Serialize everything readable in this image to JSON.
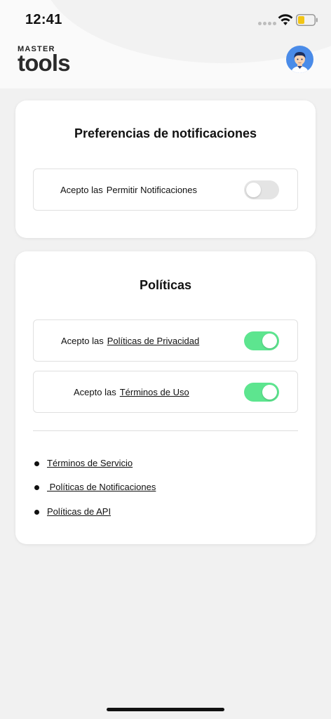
{
  "status_bar": {
    "time": "12:41"
  },
  "header": {
    "logo_top": "MASTER",
    "logo_main": "tools"
  },
  "notifications_card": {
    "title": "Preferencias de notificaciones",
    "options": [
      {
        "prefix": "Acepto las",
        "link": "Permitir Notificaciones",
        "enabled": false
      }
    ]
  },
  "policies_card": {
    "title": "Políticas",
    "options": [
      {
        "prefix": "Acepto las",
        "link": "Políticas de Privacidad",
        "enabled": true
      },
      {
        "prefix": "Acepto las",
        "link": "Términos de Uso",
        "enabled": true
      }
    ],
    "links": [
      {
        "label": "Términos de Servicio"
      },
      {
        "label": " Políticas de Notificaciones"
      },
      {
        "label": "Políticas de API"
      }
    ]
  },
  "colors": {
    "toggle_on": "#5de58f",
    "toggle_off": "#e4e4e4",
    "avatar_bg": "#4a8be8",
    "battery_fill": "#f2c515"
  },
  "icons": [
    "wifi-icon",
    "battery-icon",
    "avatar"
  ]
}
